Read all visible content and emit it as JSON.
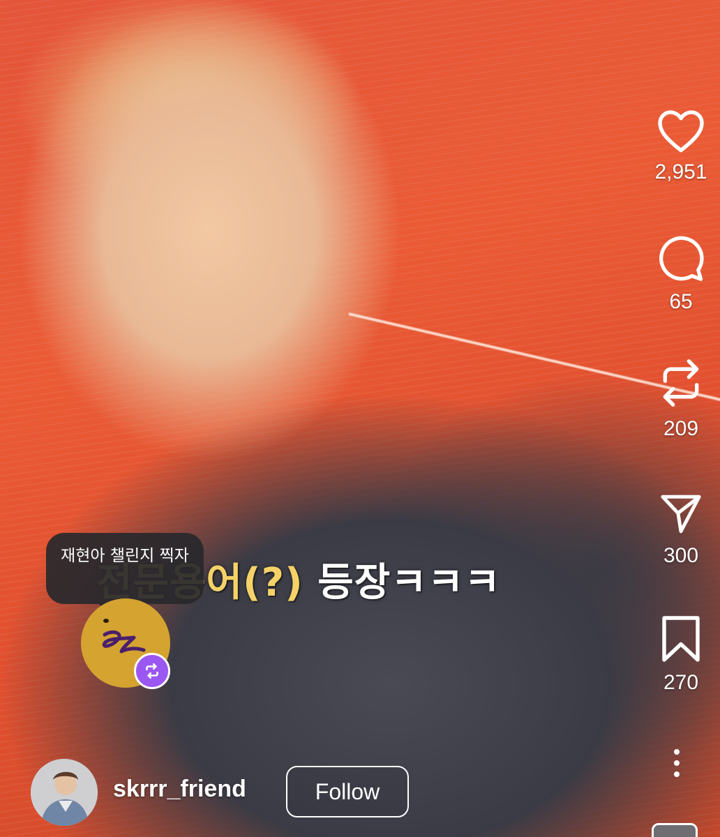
{
  "caption": {
    "part1": "전문용어(?)",
    "part2": " 등장ㅋㅋㅋ"
  },
  "comment": {
    "text": "재현아 챌린지 찍자",
    "badge_icon": "repost-icon",
    "badge_color": "#9b57f2"
  },
  "actions": [
    {
      "name": "like",
      "icon": "heart-icon",
      "count": "2,951"
    },
    {
      "name": "comment",
      "icon": "comment-icon",
      "count": "65"
    },
    {
      "name": "repost",
      "icon": "repost-icon",
      "count": "209"
    },
    {
      "name": "share",
      "icon": "send-icon",
      "count": "300"
    },
    {
      "name": "save",
      "icon": "bookmark-icon",
      "count": "270"
    }
  ],
  "more_icon": "more-vertical-icon",
  "author": {
    "username": "skrrr_friend",
    "follow_label": "Follow"
  }
}
